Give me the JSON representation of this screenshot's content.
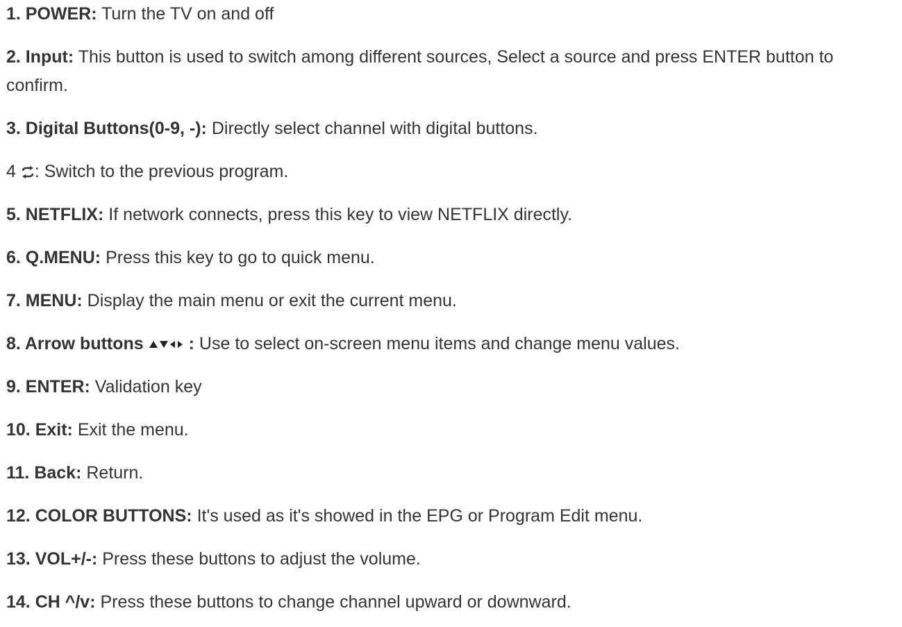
{
  "entries": [
    {
      "label": "1. POWER:",
      "desc": " Turn the TV on and off"
    },
    {
      "label": "2. Input:",
      "desc": " This button is used to switch among different sources, Select a source and press ENTER button to confirm."
    },
    {
      "label": "3. Digital Buttons(0-9, -):",
      "desc": " Directly select channel with digital buttons."
    },
    {
      "label": "",
      "prefix": "4 ",
      "icon": "swap-arrows-icon",
      "desc": ": Switch to the previous program."
    },
    {
      "label": "5. NETFLIX:",
      "desc": " If network connects, press this key to view NETFLIX directly."
    },
    {
      "label": "6. Q.MENU:",
      "desc": " Press this key to go to quick menu."
    },
    {
      "label": "7. MENU:",
      "desc": " Display the main menu or exit the current menu."
    },
    {
      "label": "8. Arrow buttons",
      "icon": "arrow-keys-icon",
      "label_suffix": ":",
      "desc": " Use to select on-screen menu items and change menu values."
    },
    {
      "label": "9. ENTER:",
      "desc": " Validation key"
    },
    {
      "label": "10. Exit:",
      "desc": " Exit the menu."
    },
    {
      "label": "11. Back:",
      "desc": " Return."
    },
    {
      "label": "12. COLOR BUTTONS:",
      "desc": " It's used as it's showed in the EPG or Program Edit menu."
    },
    {
      "label": "13. VOL+/-:",
      "desc": " Press these buttons to adjust the volume."
    },
    {
      "label": "14. CH ^/v:",
      "desc": " Press these buttons to change channel upward or downward."
    }
  ],
  "colors": {
    "text": "#333333",
    "background": "#ffffff"
  }
}
